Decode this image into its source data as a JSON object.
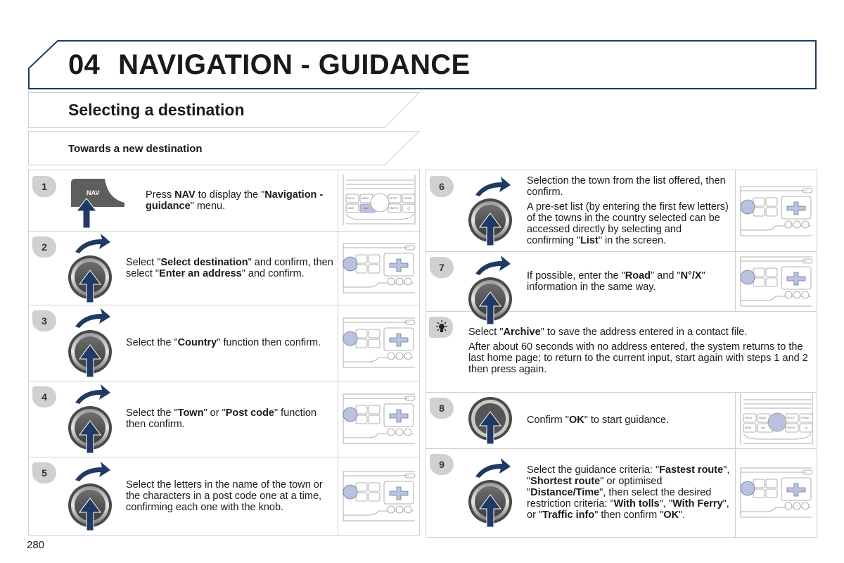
{
  "chapter": {
    "number": "04",
    "title": "NAVIGATION - GUIDANCE"
  },
  "section": {
    "title": "Selecting a destination"
  },
  "subsection": {
    "title": "Towards a new destination"
  },
  "colors": {
    "accent_navy": "#1f3a63",
    "badge_gray": "#d0d0d0",
    "highlight_blue": "#b9c3dd"
  },
  "left_steps": [
    {
      "badge": "1",
      "icon": "nav-button-press-icon",
      "button_label": "NAV",
      "parts": [
        [
          "Press ",
          false
        ],
        [
          "NAV",
          true
        ],
        [
          " to display the ",
          false
        ],
        [
          "\"",
          false
        ],
        [
          "Navigation - guidance",
          true
        ],
        [
          "\" menu.",
          false
        ]
      ],
      "unit": "radio-panel-nav-highlight"
    },
    {
      "badge": "2",
      "icon": "rotary-knob-icon",
      "parts": [
        [
          "Select \"",
          false
        ],
        [
          "Select destination",
          true
        ],
        [
          "\" and confirm, then select \"",
          false
        ],
        [
          "Enter an address",
          true
        ],
        [
          "\" and confirm.",
          false
        ]
      ],
      "unit": "radio-panel-knob-highlight"
    },
    {
      "badge": "3",
      "icon": "rotary-knob-icon",
      "parts": [
        [
          "Select the \"",
          false
        ],
        [
          "Country",
          true
        ],
        [
          "\" function then confirm.",
          false
        ]
      ],
      "unit": "radio-panel-knob-highlight"
    },
    {
      "badge": "4",
      "icon": "rotary-knob-icon",
      "parts": [
        [
          "Select the \"",
          false
        ],
        [
          "Town",
          true
        ],
        [
          "\" or \"",
          false
        ],
        [
          "Post code",
          true
        ],
        [
          "\" function then confirm.",
          false
        ]
      ],
      "unit": "radio-panel-knob-highlight"
    },
    {
      "badge": "5",
      "icon": "rotary-knob-icon",
      "parts": [
        [
          "Select the letters in the name of the town or the characters in a post code one at a time, confirming each one with the knob.",
          false
        ]
      ],
      "unit": "radio-panel-knob-highlight"
    }
  ],
  "right_steps": [
    {
      "badge": "6",
      "icon": "rotary-knob-icon",
      "paragraphs": [
        [
          [
            "Selection the town from the list offered, then confirm.",
            false
          ]
        ],
        [
          [
            "A pre-set list (by entering the first few letters) of the towns in the country selected can be accessed directly by selecting and confirming \"",
            false
          ],
          [
            "List",
            true
          ],
          [
            "\" in the screen.",
            false
          ]
        ]
      ]
    },
    {
      "badge": "7",
      "icon": "rotary-knob-icon",
      "paragraphs": [
        [
          [
            "If possible, enter the \"",
            false
          ],
          [
            "Road",
            true
          ],
          [
            "\" and \"",
            false
          ],
          [
            "N°/X",
            true
          ],
          [
            "\" information in the same way.",
            false
          ]
        ]
      ]
    },
    {
      "badge": "tip",
      "icon": "lightbulb-tip-icon",
      "paragraphs": [
        [
          [
            "Select \"",
            false
          ],
          [
            "Archive",
            true
          ],
          [
            "\" to save the address entered in a contact file.",
            false
          ]
        ],
        [
          [
            "After about 60 seconds with no address entered, the system returns to the last home page; to return to the current input, start again with steps 1 and 2 then press again.",
            false
          ]
        ]
      ]
    },
    {
      "badge": "8",
      "icon": "knob-press-icon",
      "paragraphs": [
        [
          [
            "Confirm \"",
            false
          ],
          [
            "OK",
            true
          ],
          [
            "\" to start guidance.",
            false
          ]
        ]
      ]
    },
    {
      "badge": "9",
      "icon": "rotary-knob-icon",
      "paragraphs": [
        [
          [
            "Select the guidance criteria: \"",
            false
          ],
          [
            "Fastest route",
            true
          ],
          [
            "\", \"",
            false
          ],
          [
            "Shortest route",
            true
          ],
          [
            "\" or optimised \"",
            false
          ],
          [
            "Distance/Time",
            true
          ],
          [
            "\", then select the desired restriction criteria: \"",
            false
          ],
          [
            "With tolls",
            true
          ],
          [
            "\", \"",
            false
          ],
          [
            "With Ferry",
            true
          ],
          [
            "\", or \"",
            false
          ],
          [
            "Traffic info",
            true
          ],
          [
            "\" then confirm \"",
            false
          ],
          [
            "OK",
            true
          ],
          [
            "\".",
            false
          ]
        ]
      ]
    }
  ],
  "radio_panel_labels": {
    "radio": "RADIO",
    "music": "MUSIC",
    "setup": "SETUP",
    "phone": "PHONE",
    "mode": "MODE",
    "nav": "NAV",
    "traffic": "TRAFFIC"
  },
  "page_number": "280"
}
